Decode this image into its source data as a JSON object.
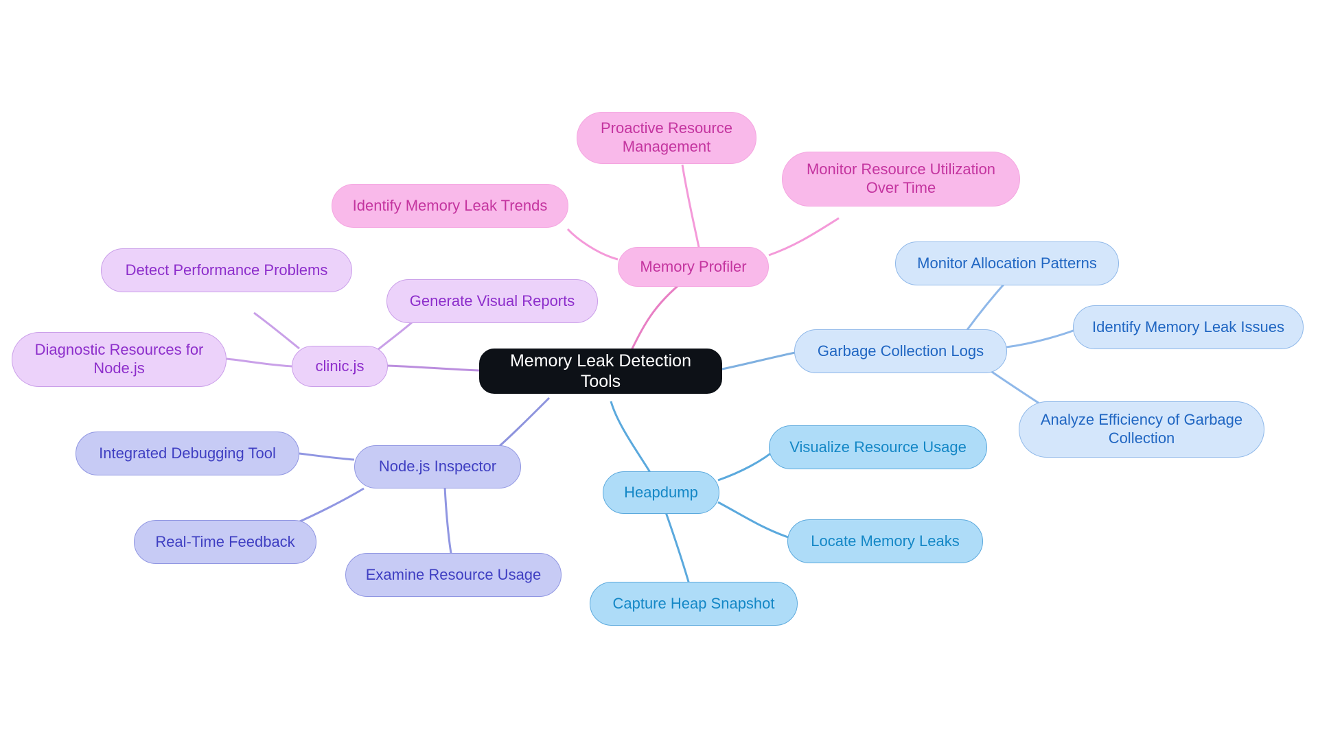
{
  "diagram": {
    "type": "mindmap",
    "title": "Memory Leak Detection Tools",
    "background": "#ffffff",
    "palette": {
      "root_fill": "#0d1117",
      "root_text": "#ffffff",
      "pink_fill": "#f9b9ea",
      "pink_text": "#c4349f",
      "purple_fill": "#ecd2fa",
      "purple_text": "#8d2ecb",
      "indigo_fill": "#c7cbf5",
      "indigo_text": "#3f3fc2",
      "cyan_fill": "#aedcf8",
      "cyan_text": "#1487c6",
      "blue_fill": "#d4e6fb",
      "blue_text": "#2066c2"
    }
  },
  "nodes": {
    "root": {
      "label": "Memory Leak Detection Tools"
    },
    "memory_profiler": {
      "label": "Memory Profiler"
    },
    "proactive_resource_management": {
      "label": "Proactive Resource\nManagement"
    },
    "identify_memory_leak_trends": {
      "label": "Identify Memory Leak Trends"
    },
    "monitor_resource_utilization": {
      "label": "Monitor Resource Utilization\nOver Time"
    },
    "clinic_js": {
      "label": "clinic.js"
    },
    "detect_performance_problems": {
      "label": "Detect Performance Problems"
    },
    "generate_visual_reports": {
      "label": "Generate Visual Reports"
    },
    "diagnostic_resources_nodejs": {
      "label": "Diagnostic Resources for\nNode.js"
    },
    "nodejs_inspector": {
      "label": "Node.js Inspector"
    },
    "integrated_debugging_tool": {
      "label": "Integrated Debugging Tool"
    },
    "real_time_feedback": {
      "label": "Real-Time Feedback"
    },
    "examine_resource_usage": {
      "label": "Examine Resource Usage"
    },
    "heapdump": {
      "label": "Heapdump"
    },
    "visualize_resource_usage": {
      "label": "Visualize Resource Usage"
    },
    "locate_memory_leaks": {
      "label": "Locate Memory Leaks"
    },
    "capture_heap_snapshot": {
      "label": "Capture Heap Snapshot"
    },
    "garbage_collection_logs": {
      "label": "Garbage Collection Logs"
    },
    "monitor_allocation_patterns": {
      "label": "Monitor Allocation Patterns"
    },
    "identify_memory_leak_issues": {
      "label": "Identify Memory Leak Issues"
    },
    "analyze_efficiency_gc": {
      "label": "Analyze Efficiency of Garbage\nCollection"
    }
  },
  "branches": [
    {
      "name": "Memory Profiler",
      "color": "#e87fc4",
      "children": [
        "Proactive Resource Management",
        "Identify Memory Leak Trends",
        "Monitor Resource Utilization Over Time"
      ]
    },
    {
      "name": "clinic.js",
      "color": "#bb8ede",
      "children": [
        "Detect Performance Problems",
        "Generate Visual Reports",
        "Diagnostic Resources for Node.js"
      ]
    },
    {
      "name": "Node.js Inspector",
      "color": "#8d93dd",
      "children": [
        "Integrated Debugging Tool",
        "Real-Time Feedback",
        "Examine Resource Usage"
      ]
    },
    {
      "name": "Heapdump",
      "color": "#5ba9dd",
      "children": [
        "Visualize Resource Usage",
        "Locate Memory Leaks",
        "Capture Heap Snapshot"
      ]
    },
    {
      "name": "Garbage Collection Logs",
      "color": "#7fb0e0",
      "children": [
        "Monitor Allocation Patterns",
        "Identify Memory Leak Issues",
        "Analyze Efficiency of Garbage Collection"
      ]
    }
  ]
}
